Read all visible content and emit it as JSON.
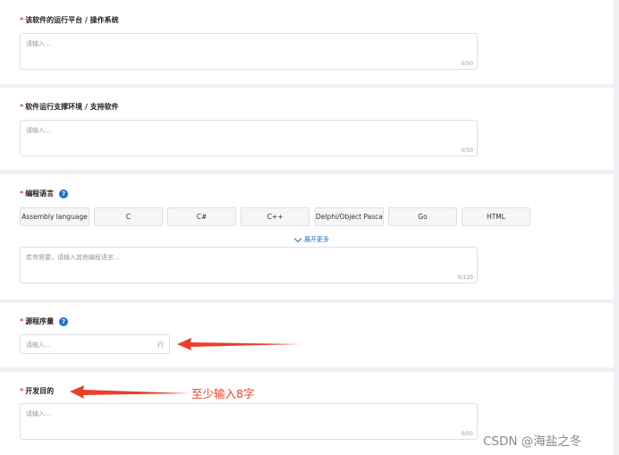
{
  "platform": {
    "title": "该软件的运行平台 / 操作系统",
    "placeholder": "请输入...",
    "count": "0/50"
  },
  "environment": {
    "title": "软件运行支撑环境 / 支持软件",
    "placeholder": "请输入...",
    "count": "0/50"
  },
  "language": {
    "title": "编程语言",
    "help": "?",
    "options": [
      "Assembly language",
      "C",
      "C#",
      "C++",
      "Delphi/Object Pascal",
      "Go",
      "HTML"
    ],
    "expand_label": "展开更多",
    "other_placeholder": "若有需要，请输入其他编程语言...",
    "other_count": "0/120"
  },
  "source_lines": {
    "title": "源程序量",
    "help": "?",
    "placeholder": "请输入...",
    "unit": "行"
  },
  "purpose": {
    "title": "开发目的",
    "placeholder": "请输入...",
    "count": "0/50"
  },
  "annotations": {
    "min_chars": "至少输入8字",
    "arrow_color": "#e8402a"
  },
  "watermark": "CSDN @海盐之冬",
  "required_mark": "*",
  "colors": {
    "accent": "#1f6fd0",
    "required": "#e8402a"
  }
}
